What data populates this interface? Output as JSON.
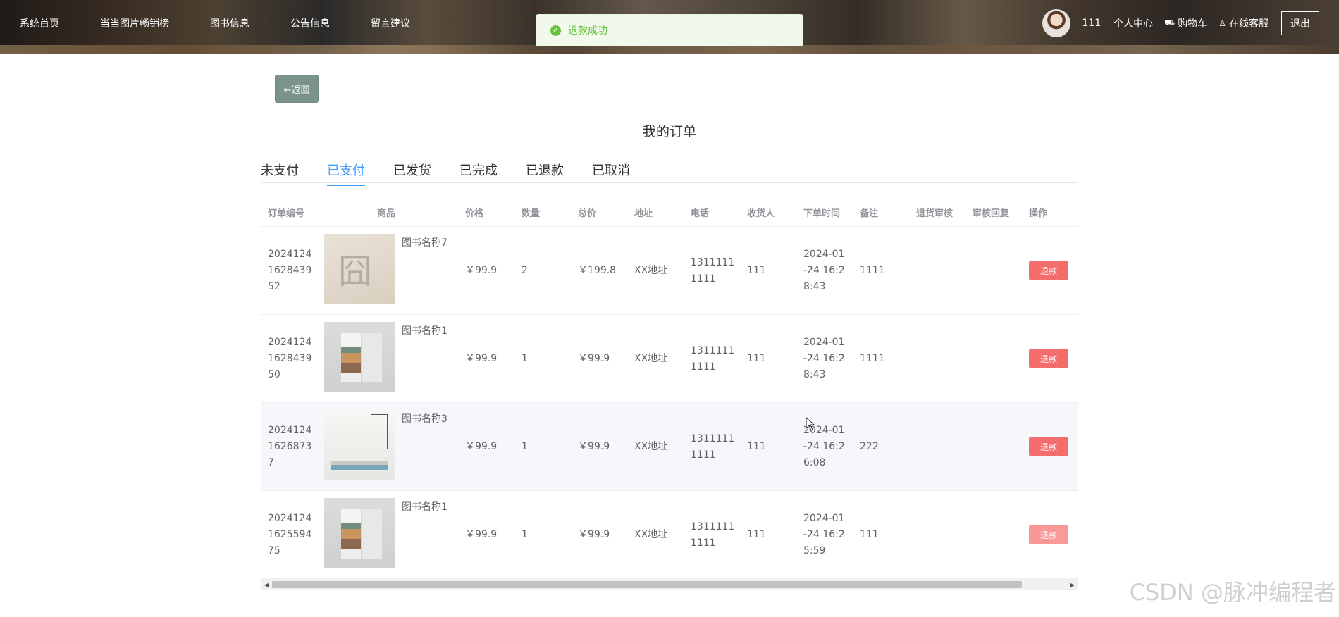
{
  "nav": {
    "items": [
      "系统首页",
      "当当图片畅销榜",
      "图书信息",
      "公告信息",
      "留言建议"
    ]
  },
  "user": {
    "name": "111",
    "personal_center": "个人中心",
    "cart": "购物车",
    "service": "在线客服",
    "logout": "退出",
    "cart_icon": "truck-icon",
    "service_icon": "person-icon"
  },
  "toast": {
    "message": "退款成功",
    "color": "#67c23a"
  },
  "back_button": "←返回",
  "page_title": "我的订单",
  "tabs": {
    "items": [
      "未支付",
      "已支付",
      "已发货",
      "已完成",
      "已退款",
      "已取消"
    ],
    "active": "已支付"
  },
  "table": {
    "columns": [
      "订单编号",
      "商品",
      "价格",
      "数量",
      "总价",
      "地址",
      "电话",
      "收货人",
      "下单时间",
      "备注",
      "退货审核",
      "审核回复",
      "操作"
    ],
    "rows": [
      {
        "order_no": [
          "2024124",
          "1628439",
          "52"
        ],
        "product": "图书名称7",
        "price": "￥99.9",
        "qty": "2",
        "total": "￥199.8",
        "address": "XX地址",
        "phone": [
          "1311111",
          "1111"
        ],
        "receiver": "111",
        "time": [
          "2024-01",
          "-24 16:2",
          "8:43"
        ],
        "remark": "1111",
        "action": "退款"
      },
      {
        "order_no": [
          "2024124",
          "1628439",
          "50"
        ],
        "product": "图书名称1",
        "price": "￥99.9",
        "qty": "1",
        "total": "￥99.9",
        "address": "XX地址",
        "phone": [
          "1311111",
          "1111"
        ],
        "receiver": "111",
        "time": [
          "2024-01",
          "-24 16:2",
          "8:43"
        ],
        "remark": "1111",
        "action": "退款"
      },
      {
        "order_no": [
          "2024124",
          "1626873",
          "7"
        ],
        "product": "图书名称3",
        "price": "￥99.9",
        "qty": "1",
        "total": "￥99.9",
        "address": "XX地址",
        "phone": [
          "1311111",
          "1111"
        ],
        "receiver": "111",
        "time": [
          "2024-01",
          "-24 16:2",
          "6:08"
        ],
        "remark": "222",
        "action": "退款"
      },
      {
        "order_no": [
          "2024124",
          "1625594",
          "75"
        ],
        "product": "图书名称1",
        "price": "￥99.9",
        "qty": "1",
        "total": "￥99.9",
        "address": "XX地址",
        "phone": [
          "1311111",
          "1111"
        ],
        "receiver": "111",
        "time": [
          "2024-01",
          "-24 16:2",
          "5:59"
        ],
        "remark": "111",
        "action": "退款"
      }
    ]
  },
  "colors": {
    "accent": "#409eff",
    "danger": "#f56c6c",
    "back": "#7b948b"
  },
  "watermark": "CSDN @脉冲编程者"
}
